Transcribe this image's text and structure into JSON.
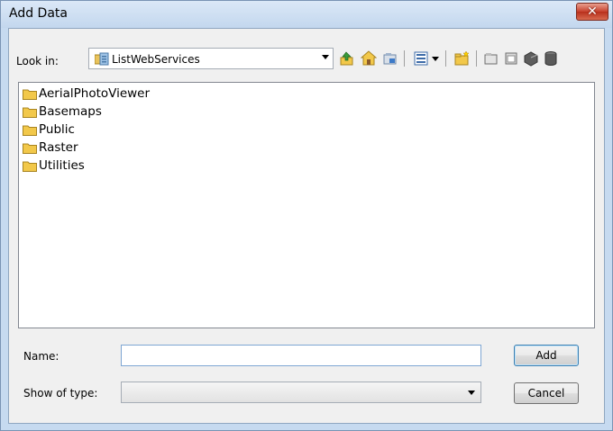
{
  "window": {
    "title": "Add Data",
    "close_glyph": "✕"
  },
  "look_in": {
    "label": "Look in:",
    "value": "ListWebServices",
    "icon": "server-folder-icon"
  },
  "toolbar": {
    "icons": [
      "up-one-level-icon",
      "home-icon",
      "connect-folder-icon",
      "view-list-icon",
      "view-dropdown-icon",
      "new-folder-icon",
      "disconnect-folder-icon",
      "catalog-icon",
      "toolbox-icon",
      "database-icon"
    ]
  },
  "file_list": {
    "items": [
      {
        "label": "AerialPhotoViewer"
      },
      {
        "label": "Basemaps"
      },
      {
        "label": "Public"
      },
      {
        "label": "Raster"
      },
      {
        "label": "Utilities"
      }
    ]
  },
  "name_field": {
    "label": "Name:",
    "value": ""
  },
  "type_field": {
    "label": "Show of type:",
    "value": ""
  },
  "buttons": {
    "add": "Add",
    "cancel": "Cancel"
  },
  "colors": {
    "folder": "#f2c84a",
    "accent": "#3c7fb1",
    "close": "#c7402c"
  }
}
